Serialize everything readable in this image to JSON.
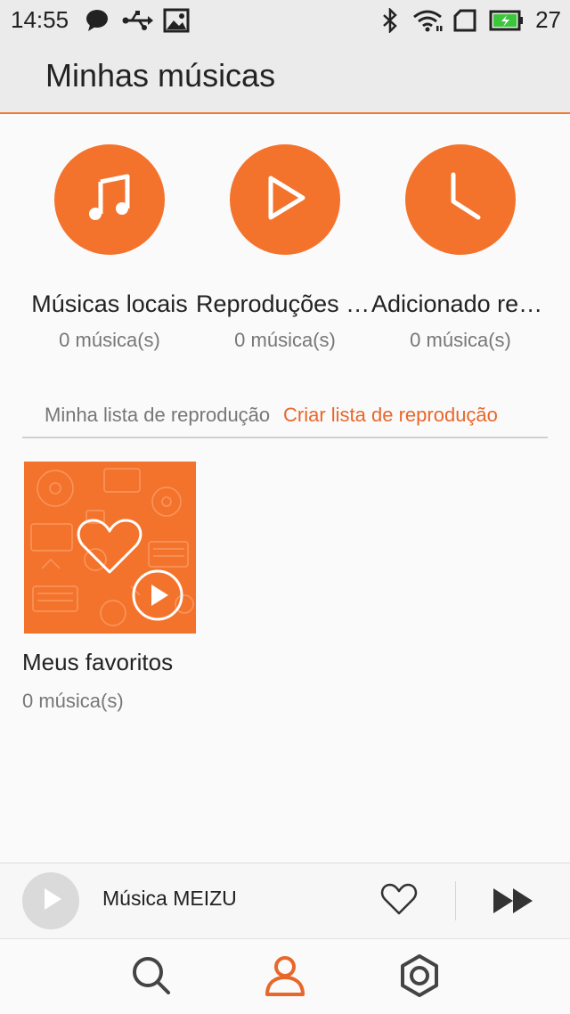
{
  "status_bar": {
    "time": "14:55",
    "battery_level": "27",
    "left_icons": [
      "chat-icon",
      "usb-icon",
      "image-icon"
    ],
    "right_icons": [
      "bluetooth-icon",
      "wifi-icon",
      "sim-icon",
      "battery-icon"
    ]
  },
  "header": {
    "title": "Minhas músicas"
  },
  "categories": [
    {
      "label": "Músicas locais",
      "count": "0 música(s)",
      "icon": "music-note-icon"
    },
    {
      "label": "Reproduções recentes",
      "count": "0 música(s)",
      "icon": "play-icon"
    },
    {
      "label": "Adicionado recentemente",
      "count": "0 música(s)",
      "icon": "clock-icon"
    }
  ],
  "playlists": {
    "title": "Minha lista de reprodução",
    "create_label": "Criar lista de reprodução",
    "items": [
      {
        "name": "Meus favoritos",
        "count": "0 música(s)"
      }
    ]
  },
  "player": {
    "title": "Música MEIZU"
  },
  "nav": {
    "items": [
      "search-icon",
      "profile-icon",
      "settings-icon"
    ],
    "active": "profile-icon"
  },
  "colors": {
    "accent": "#f4732c",
    "accent_text": "#e8672a",
    "header_bg": "#ebebeb",
    "background": "#fafafa"
  }
}
